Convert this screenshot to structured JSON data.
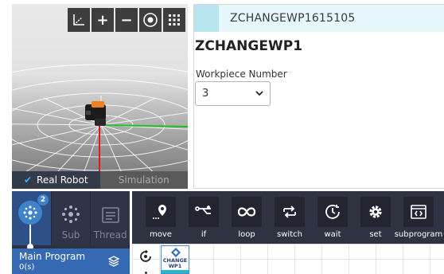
{
  "viewport": {
    "toolbar": [
      {
        "name": "axis-icon",
        "glyph": ""
      },
      {
        "name": "zoom-in-icon",
        "glyph": "+"
      },
      {
        "name": "zoom-out-icon",
        "glyph": "−"
      },
      {
        "name": "eye-icon",
        "glyph": ""
      },
      {
        "name": "grid-icon",
        "glyph": ""
      }
    ],
    "modes": {
      "real_robot": "Real Robot",
      "simulation": "Simulation",
      "active": "real_robot"
    }
  },
  "properties": {
    "header_name": "ZCHANGEWP1615105",
    "title": "ZCHANGEWP1",
    "field_label": "Workpiece Number",
    "field_value": "3",
    "accent_color": "#b9e5f0"
  },
  "program_panel": {
    "badge_count": "2",
    "sub_label": "Sub",
    "thread_label": "Thread",
    "main_program_name": "Main Program",
    "main_program_time": "0(s)"
  },
  "commands": [
    {
      "icon": "move-icon",
      "label": "move"
    },
    {
      "icon": "if-icon",
      "label": "if"
    },
    {
      "icon": "loop-icon",
      "label": "loop"
    },
    {
      "icon": "switch-icon",
      "label": "switch"
    },
    {
      "icon": "wait-icon",
      "label": "wait"
    },
    {
      "icon": "set-icon",
      "label": "set"
    },
    {
      "icon": "subprogram-icon",
      "label": "subprogram"
    }
  ],
  "timeline": {
    "block_label_line1": "CHANGE",
    "block_label_line2": "WP1",
    "block_color": "#28b9c8"
  }
}
